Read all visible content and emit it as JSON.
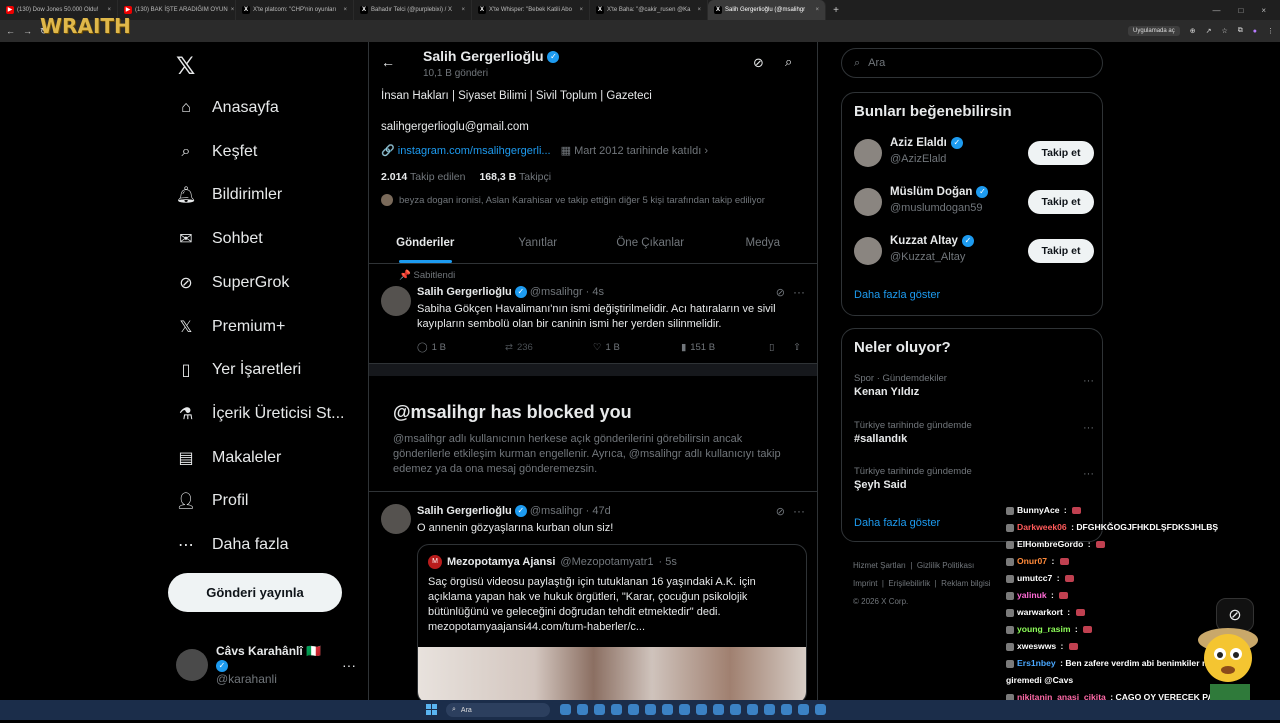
{
  "browser": {
    "tabs": [
      {
        "label": "(130) Dow Jones 50.000 Oldu!",
        "type": "yt"
      },
      {
        "label": "(130) BAK İŞTE ARADIĞIM OYUN",
        "type": "yt"
      },
      {
        "label": "X'te platcom: \"CHP'nin oyunları",
        "type": "x"
      },
      {
        "label": "Bahadır Telci (@purplebixi) / X",
        "type": "x"
      },
      {
        "label": "X'te Whisper: \"Bebek Katili Abo",
        "type": "x"
      },
      {
        "label": "X'te Baha: \"@cakir_rusen @Ka",
        "type": "x"
      },
      {
        "label": "Salih Gergerlioğlu (@msalihgr",
        "type": "x",
        "active": true
      }
    ],
    "overlay_logo": "WRAITH",
    "app_prompt": "Uygulamada aç"
  },
  "left_nav": {
    "items": [
      {
        "label": "Anasayfa",
        "icon": "home-icon"
      },
      {
        "label": "Keşfet",
        "icon": "search-icon"
      },
      {
        "label": "Bildirimler",
        "icon": "bell-icon"
      },
      {
        "label": "Sohbet",
        "icon": "mail-icon"
      },
      {
        "label": "SuperGrok",
        "icon": "grok-icon"
      },
      {
        "label": "Premium+",
        "icon": "x-icon"
      },
      {
        "label": "Yer İşaretleri",
        "icon": "bookmark-icon"
      },
      {
        "label": "İçerik Üreticisi St...",
        "icon": "flask-icon"
      },
      {
        "label": "Makaleler",
        "icon": "article-icon"
      },
      {
        "label": "Profil",
        "icon": "person-icon"
      },
      {
        "label": "Daha fazla",
        "icon": "more-circle-icon"
      }
    ],
    "post_button": "Gönderi yayınla",
    "account": {
      "name": "Câvs Karahânlî 🇮🇹",
      "handle": "@karahanli"
    }
  },
  "profile": {
    "name": "Salih Gergerlioğlu",
    "post_count": "10,1 B gönderi",
    "bio": "İnsan Hakları | Siyaset Bilimi | Sivil Toplum | Gazeteci",
    "email": "salihgergerlioglu@gmail.com",
    "link": "instagram.com/msalihgergerli...",
    "joined": "Mart 2012 tarihinde katıldı",
    "following": "2.014",
    "following_label": "Takip edilen",
    "followers": "168,3 B",
    "followers_label": "Takipçi",
    "known_followers": "beyza dogan ironisi, Aslan Karahisar ve takip ettiğin diğer 5 kişi tarafından takip ediliyor"
  },
  "tabs": [
    "Gönderiler",
    "Yanıtlar",
    "Öne Çıkanlar",
    "Medya"
  ],
  "pinned_tweet": {
    "pinned_label": "Sabitlendi",
    "name": "Salih Gergerlioğlu",
    "handle": "@msalihgr",
    "time": "· 4s",
    "text": "Sabiha Gökçen Havalimanı'nın ismi değiştirilmelidir. Acı hatıraların ve sivil kayıpların sembolü olan bir caninin ismi her yerden silinmelidir.",
    "replies": "1 B",
    "reposts": "236",
    "likes": "1 B",
    "views": "151 B"
  },
  "blocked": {
    "title": "@msalihgr has blocked you",
    "message": "@msalihgr adlı kullanıcının herkese açık gönderilerini görebilirsin ancak gönderilerle etkileşim kurman engellenir. Ayrıca, @msalihgr adlı kullanıcıyı takip edemez ya da ona mesaj gönderemezsin."
  },
  "second_tweet": {
    "name": "Salih Gergerlioğlu",
    "handle": "@msalihgr",
    "time": "· 47d",
    "text": "O annenin gözyaşlarına kurban olun siz!",
    "quote": {
      "name": "Mezopotamya Ajansi",
      "handle": "@Mezopotamyatr1",
      "time": "· 5s",
      "text": "Saç örgüsü videosu paylaştığı için tutuklanan 16 yaşındaki A.K. için açıklama yapan hak ve hukuk örgütleri, \"Karar, çocuğun psikolojik bütünlüğünü ve geleceğini doğrudan tehdit etmektedir\" dedi. mezopotamyaajansi44.com/tum-haberler/c..."
    }
  },
  "right": {
    "search_placeholder": "Ara",
    "suggestions_title": "Bunları beğenebilirsin",
    "suggestions": [
      {
        "name": "Aziz Elaldı",
        "handle": "@AzizElald",
        "button": "Takip et"
      },
      {
        "name": "Müslüm Doğan",
        "handle": "@muslumdogan59",
        "button": "Takip et"
      },
      {
        "name": "Kuzzat Altay",
        "handle": "@Kuzzat_Altay",
        "button": "Takip et"
      }
    ],
    "show_more": "Daha fazla göster",
    "trends_title": "Neler oluyor?",
    "trends": [
      {
        "context": "Spor · Gündemdekiler",
        "name": "Kenan Yıldız"
      },
      {
        "context": "Türkiye tarihinde gündemde",
        "name": "#sallandık"
      },
      {
        "context": "Türkiye tarihinde gündemde",
        "name": "Şeyh Said"
      }
    ],
    "footer": [
      "Hizmet Şartları",
      "Gizlilik Politikası",
      "Imprint",
      "Erişilebilirlik",
      "Reklam bilgisi",
      "© 2026 X Corp."
    ]
  },
  "chat": [
    {
      "user": "BunnyAce",
      "msg": "",
      "color": "#ffffff"
    },
    {
      "user": "Darkweek06",
      "msg": "DFGHKĞOGJFHKDLŞFDKSJHLBŞ",
      "color": "#ff5a5a"
    },
    {
      "user": "ElHombreGordo",
      "msg": "",
      "color": "#ffffff"
    },
    {
      "user": "Onur07",
      "msg": "",
      "color": "#ff8a3a"
    },
    {
      "user": "umutcc7",
      "msg": "",
      "color": "#ffffff"
    },
    {
      "user": "yalinuk",
      "msg": "",
      "color": "#ff6ad5"
    },
    {
      "user": "warwarkort",
      "msg": "",
      "color": "#ffffff"
    },
    {
      "user": "young_rasim",
      "msg": "",
      "color": "#8fff5a"
    },
    {
      "user": "xweswws",
      "msg": "",
      "color": "#ffffff"
    },
    {
      "user": "Ers1nbey",
      "msg": "Ben zafere verdim abi benimkiler meclise bile giremedi @Cavs",
      "color": "#4aa8ff"
    },
    {
      "user": "nikitanin_anasi_cikita",
      "msg": "CAGO OY VERECEK PARTİ YOK DİNÖMÜ AÇ ONA OY VEREK BOŞA GİTMESİN",
      "color": "#ff6aa8"
    }
  ],
  "taskbar": {
    "search": "Ara"
  }
}
